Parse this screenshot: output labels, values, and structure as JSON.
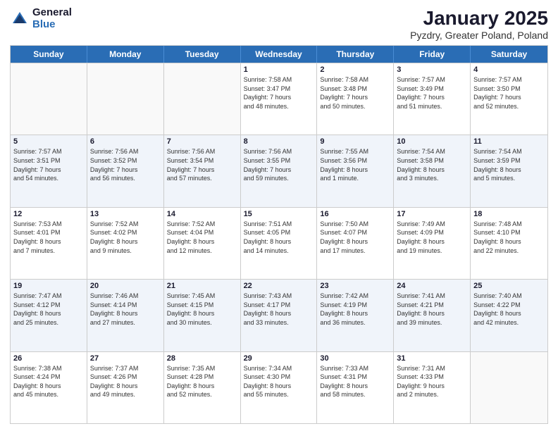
{
  "header": {
    "logo_general": "General",
    "logo_blue": "Blue",
    "title": "January 2025",
    "location": "Pyzdry, Greater Poland, Poland"
  },
  "days_of_week": [
    "Sunday",
    "Monday",
    "Tuesday",
    "Wednesday",
    "Thursday",
    "Friday",
    "Saturday"
  ],
  "weeks": [
    [
      {
        "day": "",
        "text": ""
      },
      {
        "day": "",
        "text": ""
      },
      {
        "day": "",
        "text": ""
      },
      {
        "day": "1",
        "text": "Sunrise: 7:58 AM\nSunset: 3:47 PM\nDaylight: 7 hours\nand 48 minutes."
      },
      {
        "day": "2",
        "text": "Sunrise: 7:58 AM\nSunset: 3:48 PM\nDaylight: 7 hours\nand 50 minutes."
      },
      {
        "day": "3",
        "text": "Sunrise: 7:57 AM\nSunset: 3:49 PM\nDaylight: 7 hours\nand 51 minutes."
      },
      {
        "day": "4",
        "text": "Sunrise: 7:57 AM\nSunset: 3:50 PM\nDaylight: 7 hours\nand 52 minutes."
      }
    ],
    [
      {
        "day": "5",
        "text": "Sunrise: 7:57 AM\nSunset: 3:51 PM\nDaylight: 7 hours\nand 54 minutes."
      },
      {
        "day": "6",
        "text": "Sunrise: 7:56 AM\nSunset: 3:52 PM\nDaylight: 7 hours\nand 56 minutes."
      },
      {
        "day": "7",
        "text": "Sunrise: 7:56 AM\nSunset: 3:54 PM\nDaylight: 7 hours\nand 57 minutes."
      },
      {
        "day": "8",
        "text": "Sunrise: 7:56 AM\nSunset: 3:55 PM\nDaylight: 7 hours\nand 59 minutes."
      },
      {
        "day": "9",
        "text": "Sunrise: 7:55 AM\nSunset: 3:56 PM\nDaylight: 8 hours\nand 1 minute."
      },
      {
        "day": "10",
        "text": "Sunrise: 7:54 AM\nSunset: 3:58 PM\nDaylight: 8 hours\nand 3 minutes."
      },
      {
        "day": "11",
        "text": "Sunrise: 7:54 AM\nSunset: 3:59 PM\nDaylight: 8 hours\nand 5 minutes."
      }
    ],
    [
      {
        "day": "12",
        "text": "Sunrise: 7:53 AM\nSunset: 4:01 PM\nDaylight: 8 hours\nand 7 minutes."
      },
      {
        "day": "13",
        "text": "Sunrise: 7:52 AM\nSunset: 4:02 PM\nDaylight: 8 hours\nand 9 minutes."
      },
      {
        "day": "14",
        "text": "Sunrise: 7:52 AM\nSunset: 4:04 PM\nDaylight: 8 hours\nand 12 minutes."
      },
      {
        "day": "15",
        "text": "Sunrise: 7:51 AM\nSunset: 4:05 PM\nDaylight: 8 hours\nand 14 minutes."
      },
      {
        "day": "16",
        "text": "Sunrise: 7:50 AM\nSunset: 4:07 PM\nDaylight: 8 hours\nand 17 minutes."
      },
      {
        "day": "17",
        "text": "Sunrise: 7:49 AM\nSunset: 4:09 PM\nDaylight: 8 hours\nand 19 minutes."
      },
      {
        "day": "18",
        "text": "Sunrise: 7:48 AM\nSunset: 4:10 PM\nDaylight: 8 hours\nand 22 minutes."
      }
    ],
    [
      {
        "day": "19",
        "text": "Sunrise: 7:47 AM\nSunset: 4:12 PM\nDaylight: 8 hours\nand 25 minutes."
      },
      {
        "day": "20",
        "text": "Sunrise: 7:46 AM\nSunset: 4:14 PM\nDaylight: 8 hours\nand 27 minutes."
      },
      {
        "day": "21",
        "text": "Sunrise: 7:45 AM\nSunset: 4:15 PM\nDaylight: 8 hours\nand 30 minutes."
      },
      {
        "day": "22",
        "text": "Sunrise: 7:43 AM\nSunset: 4:17 PM\nDaylight: 8 hours\nand 33 minutes."
      },
      {
        "day": "23",
        "text": "Sunrise: 7:42 AM\nSunset: 4:19 PM\nDaylight: 8 hours\nand 36 minutes."
      },
      {
        "day": "24",
        "text": "Sunrise: 7:41 AM\nSunset: 4:21 PM\nDaylight: 8 hours\nand 39 minutes."
      },
      {
        "day": "25",
        "text": "Sunrise: 7:40 AM\nSunset: 4:22 PM\nDaylight: 8 hours\nand 42 minutes."
      }
    ],
    [
      {
        "day": "26",
        "text": "Sunrise: 7:38 AM\nSunset: 4:24 PM\nDaylight: 8 hours\nand 45 minutes."
      },
      {
        "day": "27",
        "text": "Sunrise: 7:37 AM\nSunset: 4:26 PM\nDaylight: 8 hours\nand 49 minutes."
      },
      {
        "day": "28",
        "text": "Sunrise: 7:35 AM\nSunset: 4:28 PM\nDaylight: 8 hours\nand 52 minutes."
      },
      {
        "day": "29",
        "text": "Sunrise: 7:34 AM\nSunset: 4:30 PM\nDaylight: 8 hours\nand 55 minutes."
      },
      {
        "day": "30",
        "text": "Sunrise: 7:33 AM\nSunset: 4:31 PM\nDaylight: 8 hours\nand 58 minutes."
      },
      {
        "day": "31",
        "text": "Sunrise: 7:31 AM\nSunset: 4:33 PM\nDaylight: 9 hours\nand 2 minutes."
      },
      {
        "day": "",
        "text": ""
      }
    ]
  ]
}
